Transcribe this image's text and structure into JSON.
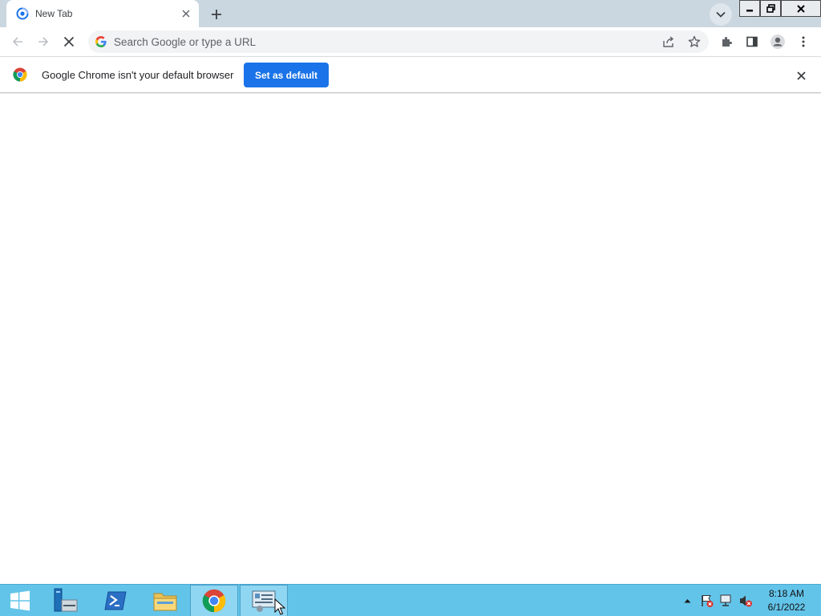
{
  "browser": {
    "tab": {
      "title": "New Tab"
    },
    "omnibox": {
      "placeholder": "Search Google or type a URL",
      "value": ""
    }
  },
  "infobar": {
    "message": "Google Chrome isn't your default browser",
    "button_label": "Set as default"
  },
  "taskbar": {
    "clock": {
      "time": "8:18 AM",
      "date": "6/1/2022"
    }
  },
  "colors": {
    "tabstrip_bg": "#cad7e0",
    "accent_blue": "#1a73e8",
    "taskbar_bg": "#63c4ea"
  },
  "icons": [
    "chrome-newtab-favicon",
    "close-icon",
    "plus-icon",
    "chevron-down-icon",
    "minimize-icon",
    "restore-icon",
    "arrow-left-icon",
    "arrow-right-icon",
    "stop-icon",
    "google-g-icon",
    "share-icon",
    "star-icon",
    "puzzle-icon",
    "side-panel-icon",
    "profile-icon",
    "kebab-menu-icon",
    "chrome-logo",
    "windows-logo",
    "server-manager-icon",
    "powershell-icon",
    "file-explorer-icon",
    "control-panel-icon",
    "tray-up-arrow-icon",
    "flag-alert-icon",
    "network-icon",
    "volume-muted-icon",
    "mouse-cursor"
  ]
}
